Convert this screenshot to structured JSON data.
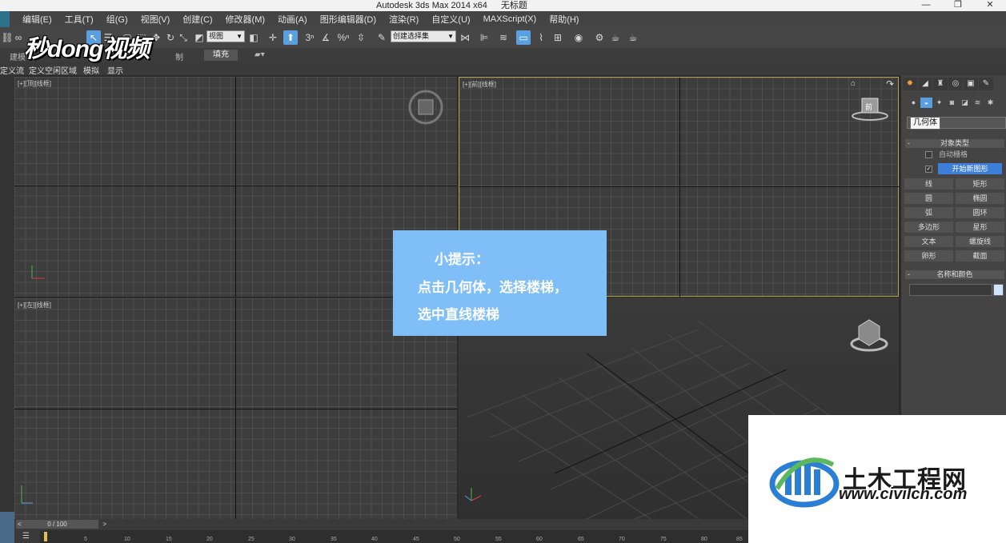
{
  "window": {
    "app_title": "Autodesk 3ds Max  2014 x64",
    "doc_title": "无标题",
    "minimize": "—",
    "restore": "❐",
    "close": "✕"
  },
  "menu": [
    "编辑(E)",
    "工具(T)",
    "组(G)",
    "视图(V)",
    "创建(C)",
    "修改器(M)",
    "动画(A)",
    "图形编辑器(D)",
    "渲染(R)",
    "自定义(U)",
    "MAXScript(X)",
    "帮助(H)"
  ],
  "toolbar": {
    "view_dropdown": "视图",
    "selection_set_dropdown": "创建选择集"
  },
  "ribbon": {
    "tab_modeling": "建模",
    "tab_freeform": "制",
    "tab_fill": "填充"
  },
  "subribbon": [
    "定义流",
    "定义空闲区域",
    "模拟",
    "显示"
  ],
  "viewports": {
    "top": "[+][顶][线框]",
    "front": "[+][前][线框]",
    "left": "[+][左][线框]",
    "front_cube_label": "前"
  },
  "tip": {
    "line1": "小提示：",
    "line2": "点击几何体，选择楼梯，",
    "line3": "选中直线楼梯"
  },
  "command_panel": {
    "tooltip": "几何体",
    "rollout_object_type": "对象类型",
    "auto_grid": "自动栅格",
    "start_new_shape": "开始新图形",
    "buttons": [
      "线",
      "矩形",
      "圆",
      "椭圆",
      "弧",
      "圆环",
      "多边形",
      "星形",
      "文本",
      "螺旋线",
      "卵形",
      "截面"
    ],
    "rollout_name_color": "名称和颜色"
  },
  "timeline": {
    "slider": "0 / 100",
    "ticks": [
      "5",
      "10",
      "15",
      "20",
      "25",
      "30",
      "35",
      "40",
      "45",
      "50",
      "55",
      "60",
      "65",
      "70",
      "75",
      "80",
      "85"
    ]
  },
  "watermark": {
    "mdong_logo": "秒dong视频",
    "site_name": "土木工程网",
    "site_url": "www.civilcn.com"
  },
  "colors": {
    "accent_blue": "#3d7fd8",
    "tip_bg": "#7fbef7",
    "active_viewport_border": "#b5a24a"
  }
}
